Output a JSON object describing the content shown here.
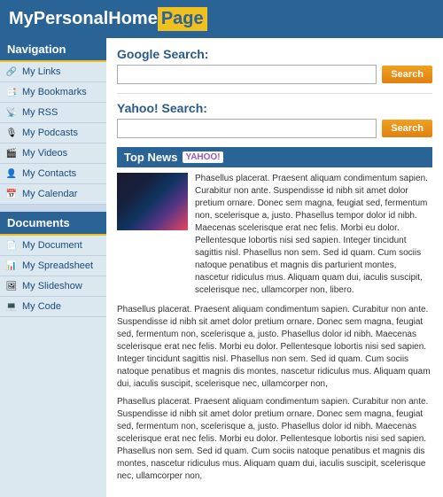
{
  "header": {
    "title_main": "MyPersonalHome",
    "title_highlight": "Page"
  },
  "sidebar": {
    "nav_header": "Navigation",
    "nav_items": [
      {
        "label": "My Links",
        "icon": "🔗"
      },
      {
        "label": "My Bookmarks",
        "icon": "📑"
      },
      {
        "label": "My RSS",
        "icon": "📡"
      },
      {
        "label": "My Podcasts",
        "icon": "🎙"
      },
      {
        "label": "My Videos",
        "icon": "🎬"
      },
      {
        "label": "My Contacts",
        "icon": "👤"
      },
      {
        "label": "My Calendar",
        "icon": "📅"
      }
    ],
    "docs_header": "Documents",
    "docs_items": [
      {
        "label": "My Document",
        "icon": "📄"
      },
      {
        "label": "My Spreadsheet",
        "icon": "📊"
      },
      {
        "label": "My Slideshow",
        "icon": "🖼"
      },
      {
        "label": "My Code",
        "icon": "💻"
      }
    ]
  },
  "main": {
    "google_label": "Google Search:",
    "google_placeholder": "",
    "google_button": "Search",
    "yahoo_label": "Yahoo! Search:",
    "yahoo_placeholder": "",
    "yahoo_button": "Search",
    "top_news_label": "Top News",
    "top_news_source": "YAHOO!",
    "news_para1": "Phasellus placerat. Praesent aliquam condimentum sapien. Curabitur non ante. Suspendisse id nibh sit amet dolor pretium ornare. Donec sem magna, feugiat sed, fermentum non, scelerisque a, justo. Phasellus tempor dolor id nibh. Maecenas scelerisque erat nec felis. Morbi eu dolor. Pellentesque lobortis nisi sed sapien. Integer tincidunt sagittis nisl. Phasellus non sem. Sed id quam. Cum sociis natoque penatibus et magnis dis parturient montes, nascetur ridiculus mus. Aliquam quam dui, iaculis suscipit, scelerisque nec, ullamcorper non, libero.",
    "news_para2": "Phasellus placerat. Praesent aliquam condimentum sapien. Curabitur non ante. Suspendisse id nibh sit amet dolor pretium ornare. Donec sem magna, feugiat sed, fermentum non, scelerisque a, justo. Phasellus dolor id nibh. Maecenas scelerisque erat nec felis. Morbi eu dolor. Pellentesque lobortis nisi sed sapien. Integer tincidunt sagittis nisl. Phasellus non sem. Sed id quam. Cum sociis natoque penatibus et magnis dis montes, nascetur ridiculus mus. Aliquam quam dui, iaculis suscipit, scelerisque nec, ullamcorper non,",
    "news_para3": "Phasellus placerat. Praesent aliquam condimentum sapien. Curabitur non ante. Suspendisse id nibh sit amet dolor pretium ornare. Donec sem magna, feugiat sed, fermentum non, scelerisque a, justo. Phasellus dolor id nibh. Maecenas scelerisque erat nec felis. Morbi eu dolor. Pellentesque lobortis nisi sed sapien. Phasellus non sem. Sed id quam. Cum sociis natoque penatibus et magnis dis montes, nascetur ridiculus mus. Aliquam quam dui, iaculis suscipit, scelerisque nec, ullamcorper non,"
  }
}
